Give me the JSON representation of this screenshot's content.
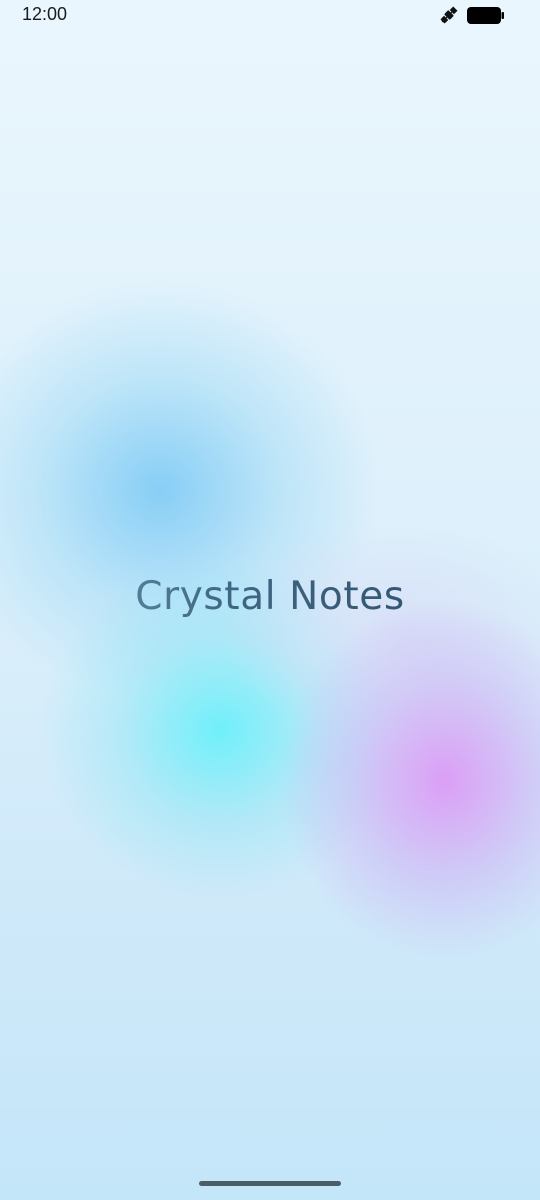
{
  "status_bar": {
    "time": "12:00",
    "icons": [
      "satellite-icon",
      "battery-icon"
    ]
  },
  "splash": {
    "app_title": "Crystal Notes"
  },
  "colors": {
    "title_start": "#6f9fb6",
    "title_end": "#2d4a66",
    "background_top": "#eaf6fd",
    "background_bottom": "#c4e6f9",
    "blob_blue": "#78c8f5",
    "blob_cyan": "#64f0fa",
    "blob_violet": "#dc96f5",
    "home_indicator": "#4b5d66"
  }
}
